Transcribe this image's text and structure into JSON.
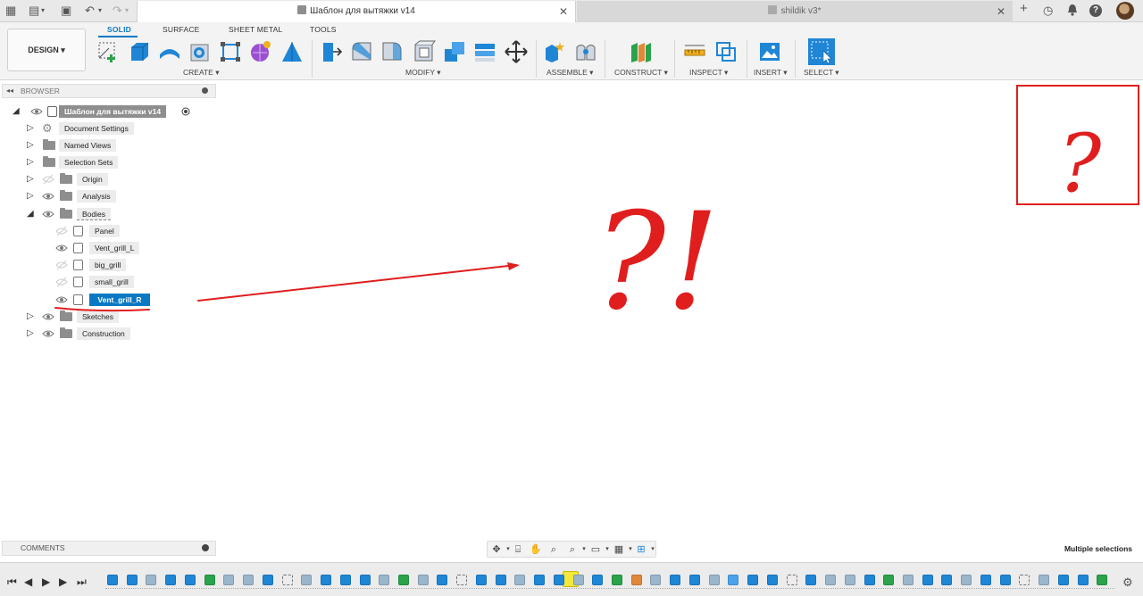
{
  "tabs": {
    "active_title": "Шаблон для вытяжки v14",
    "inactive_title": "shildik v3*",
    "close": "✕"
  },
  "topbar_icons": {
    "grid": "▦",
    "file": "▤",
    "save": "▣",
    "undo": "↶",
    "redo": "↷",
    "plus": "+",
    "clock": "◷",
    "bell": "🔔",
    "help": "?"
  },
  "ribbon": {
    "design_label": "DESIGN ▾",
    "tabs": [
      "SOLID",
      "SURFACE",
      "SHEET METAL",
      "TOOLS"
    ],
    "groups": {
      "create": "CREATE ▾",
      "modify": "MODIFY ▾",
      "assemble": "ASSEMBLE ▾",
      "construct": "CONSTRUCT ▾",
      "inspect": "INSPECT ▾",
      "insert": "INSERT ▾",
      "select": "SELECT ▾"
    }
  },
  "browser": {
    "title": "BROWSER",
    "root": "Шаблон для вытяжки v14",
    "items": [
      {
        "label": "Document Settings"
      },
      {
        "label": "Named Views"
      },
      {
        "label": "Selection Sets"
      },
      {
        "label": "Origin"
      },
      {
        "label": "Analysis"
      },
      {
        "label": "Bodies"
      },
      {
        "label": "Panel"
      },
      {
        "label": "Vent_grill_L"
      },
      {
        "label": "big_grill"
      },
      {
        "label": "small_grill"
      },
      {
        "label": "Vent_grill_R"
      },
      {
        "label": "Sketches"
      },
      {
        "label": "Construction"
      }
    ]
  },
  "annotations": {
    "text_main": "?!",
    "text_box": "?",
    "color": "#e01e1e"
  },
  "comments": {
    "title": "COMMENTS"
  },
  "status": {
    "text": "Multiple selections"
  },
  "colors": {
    "accent": "#0a78c2",
    "timeline_highlight": "#f3e83b"
  }
}
